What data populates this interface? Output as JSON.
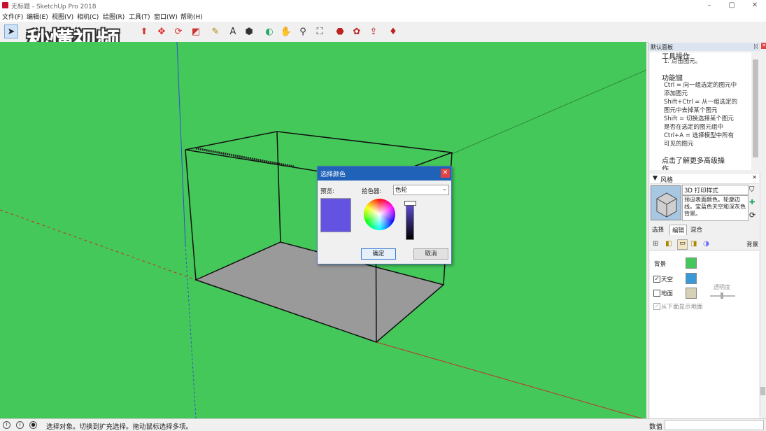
{
  "window": {
    "title": "无标题 - SketchUp Pro 2018",
    "minimize": "–",
    "maximize": "▢",
    "close": "✕"
  },
  "menu": [
    "文件(F)",
    "编辑(E)",
    "视图(V)",
    "相机(C)",
    "绘图(R)",
    "工具(T)",
    "窗口(W)",
    "帮助(H)"
  ],
  "watermark": "秒懂视频",
  "dialog": {
    "title": "选择颜色",
    "preview_label": "预览:",
    "picker_label": "拾色器:",
    "picker_value": "色轮",
    "ok": "确定",
    "cancel": "取消",
    "preview_color": "#6452e0"
  },
  "instructor": {
    "panel_title": "默认面板",
    "op_heading": "工具操作",
    "op_step": "1. 点击图元。",
    "keys_heading": "功能键",
    "keys": [
      "Ctrl = 向一组选定的图元中",
      "添加图元",
      "Shift+Ctrl = 从一组选定的",
      "图元中去掉某个图元",
      "Shift = 切换选择某个图元",
      "是否在选定的图元组中",
      "Ctrl+A = 选择模型中所有",
      "可见的图元"
    ],
    "more": "点击了解更多高级操",
    "more2": "作......"
  },
  "styles": {
    "header": "风格",
    "name": "3D 打印样式",
    "desc": "预设表面颜色。轮廓边线。宝蓝色天空和深灰色背景。",
    "tabs": [
      "选择",
      "编辑",
      "混合"
    ],
    "bg_section": "背景",
    "background_label": "背景",
    "sky_label": "天空",
    "ground_label": "地面",
    "transparency_label": "透明度",
    "show_ground_label": "从下面显示地面",
    "colors": {
      "background": "#45c85a",
      "sky": "#3a9ad8",
      "ground": "#d6d0b6"
    }
  },
  "status": {
    "text": "选择对象。切换到扩充选择。拖动鼠标选择多项。",
    "measure_label": "数值",
    "measure_value": ""
  }
}
